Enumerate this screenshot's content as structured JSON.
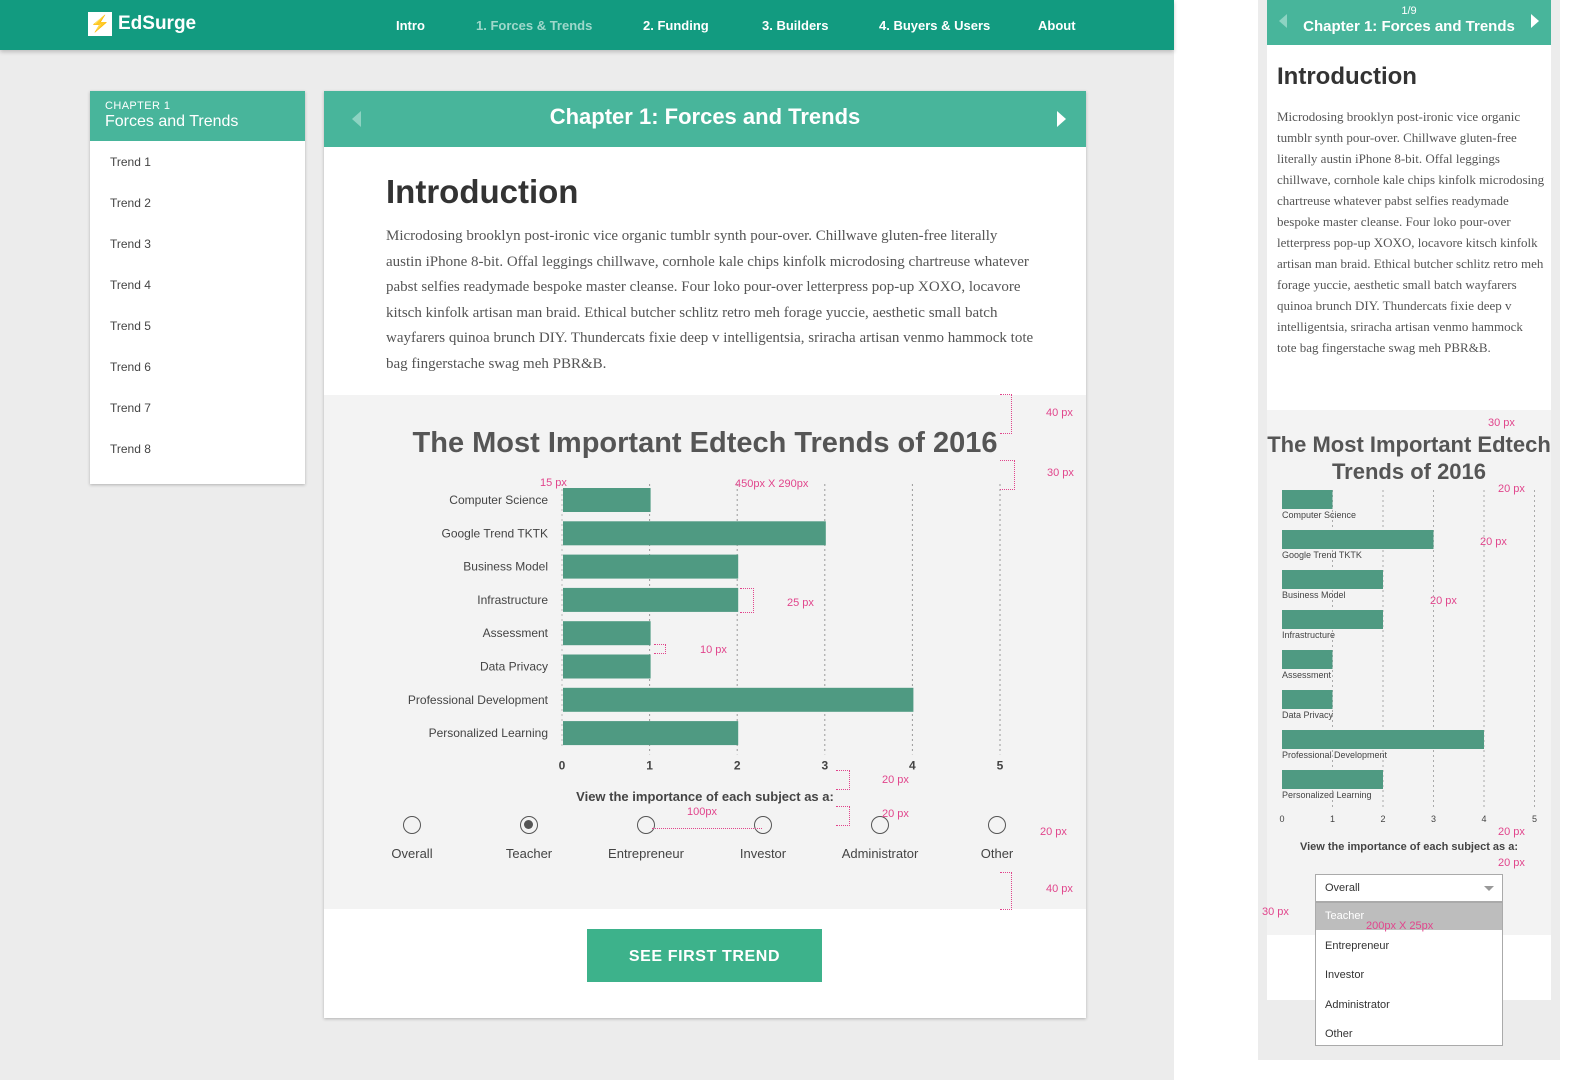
{
  "brand": {
    "name": "EdSurge",
    "mark": "⚡"
  },
  "nav": {
    "items": [
      {
        "label": "Intro"
      },
      {
        "label": "1. Forces & Trends",
        "active": true
      },
      {
        "label": "2. Funding"
      },
      {
        "label": "3. Builders"
      },
      {
        "label": "4. Buyers & Users"
      },
      {
        "label": "About"
      }
    ]
  },
  "sidebar": {
    "kicker": "CHAPTER 1",
    "title": "Forces and Trends",
    "items": [
      "Trend 1",
      "Trend 2",
      "Trend 3",
      "Trend 4",
      "Trend 5",
      "Trend 6",
      "Trend 7",
      "Trend 8"
    ]
  },
  "card": {
    "title": "Chapter 1: Forces and Trends",
    "intro_heading": "Introduction",
    "intro_text": "Microdosing brooklyn post-ironic vice organic tumblr synth pour-over. Chillwave gluten-free literally austin iPhone 8-bit. Offal leggings chillwave, cornhole kale chips kinfolk microdosing chartreuse whatever pabst selfies readymade bespoke master cleanse. Four loko pour-over letterpress pop-up XOXO, locavore kitsch kinfolk artisan man braid. Ethical butcher schlitz retro meh forage yuccie, aesthetic small batch wayfarers quinoa brunch DIY. Thundercats fixie deep v intelligentsia, sriracha artisan venmo hammock tote bag fingerstache swag meh PBR&B.",
    "chart_title": "The Most Important Edtech Trends of 2016",
    "view_label": "View the importance of each subject as a:",
    "roles": [
      {
        "label": "Overall",
        "selected": false
      },
      {
        "label": "Teacher",
        "selected": true
      },
      {
        "label": "Entrepreneur",
        "selected": false
      },
      {
        "label": "Investor",
        "selected": false
      },
      {
        "label": "Administrator",
        "selected": false
      },
      {
        "label": "Other",
        "selected": false
      }
    ],
    "cta_label": "SEE FIRST TREND"
  },
  "chart_data": [
    {
      "type": "bar",
      "orientation": "horizontal",
      "title": "The Most Important Edtech Trends of 2016",
      "categories": [
        "Computer Science",
        "Google Trend TKTK",
        "Business Model",
        "Infrastructure",
        "Assessment",
        "Data Privacy",
        "Professional Development",
        "Personalized Learning"
      ],
      "values": [
        1,
        3,
        2,
        2,
        1,
        1,
        4,
        2
      ],
      "xlim": [
        0,
        5
      ],
      "xticks": [
        0,
        1,
        2,
        3,
        4,
        5
      ],
      "grid": "vertical dotted",
      "bar_color": "#4f9a82"
    },
    {
      "type": "bar",
      "orientation": "horizontal",
      "title": "The Most Important Edtech Trends of 2016",
      "categories": [
        "Computer Science",
        "Google Trend TKTK",
        "Business Model",
        "Infrastructure",
        "Assessment",
        "Data Privacy",
        "Professional Development",
        "Personalized Learning"
      ],
      "values": [
        1,
        3,
        2,
        2,
        1,
        1,
        4,
        2
      ],
      "xlim": [
        0,
        5
      ],
      "xticks": [
        0,
        1,
        2,
        3,
        4,
        5
      ],
      "grid": "vertical dotted",
      "bar_color": "#4f9a82"
    }
  ],
  "annotations": {
    "desktop": [
      "40 px",
      "30 px",
      "15 px",
      "450px X 290px",
      "25 px",
      "10 px",
      "20 px",
      "20 px",
      "100px",
      "20 px",
      "40 px"
    ],
    "mobile": [
      "30 px",
      "20 px",
      "20 px",
      "20 px",
      "20 px",
      "20 px",
      "30 px",
      "200px X 25px"
    ]
  },
  "mobile": {
    "page": "1/9",
    "title": "Chapter 1: Forces and Trends",
    "intro_heading": "Introduction",
    "intro_text": "Microdosing brooklyn post-ironic vice organic tumblr synth pour-over. Chillwave gluten-free literally austin iPhone 8-bit. Offal leggings chillwave, cornhole kale chips kinfolk microdosing chartreuse whatever pabst selfies readymade bespoke master cleanse. Four loko pour-over letterpress pop-up XOXO, locavore kitsch kinfolk artisan man braid. Ethical butcher schlitz retro meh forage yuccie, aesthetic small batch wayfarers quinoa brunch DIY. Thundercats fixie deep v intelligentsia, sriracha artisan venmo hammock tote bag fingerstache swag meh PBR&B.",
    "chart_title": "The Most Important Edtech Trends of 2016",
    "view_label": "View the importance of each subject as a:",
    "select_value": "Overall",
    "options": [
      {
        "label": "Teacher",
        "highlighted": true
      },
      {
        "label": "Entrepreneur",
        "highlighted": false
      },
      {
        "label": "Investor",
        "highlighted": false
      },
      {
        "label": "Administrator",
        "highlighted": false
      },
      {
        "label": "Other",
        "highlighted": false
      }
    ]
  },
  "colors": {
    "brand": "#129b80",
    "header": "#48b59b",
    "bar": "#4f9a82",
    "cta": "#3db28b",
    "annotation": "#e1458c"
  }
}
